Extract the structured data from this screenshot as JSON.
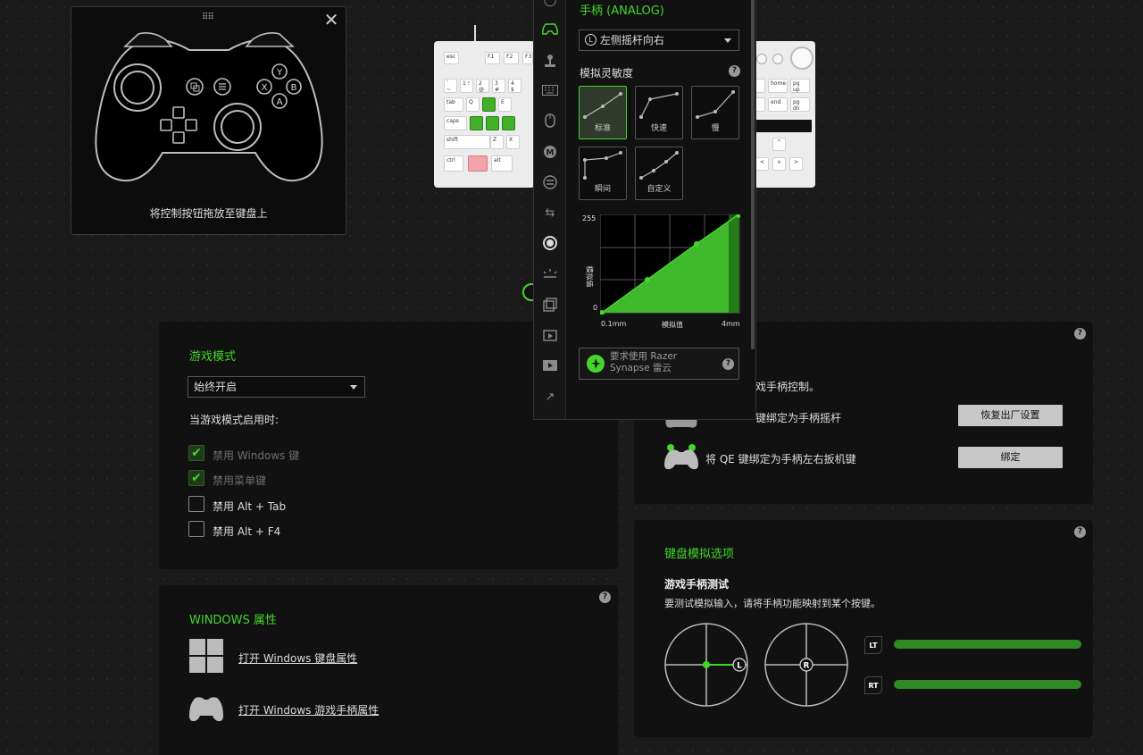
{
  "controller_panel": {
    "caption": "将控制按钮拖放至键盘上",
    "buttons": {
      "y": "Y",
      "x": "X",
      "b": "B",
      "a": "A"
    }
  },
  "keyboard": {
    "left_keys": {
      "esc": "esc",
      "f1": "F1",
      "f2": "F2",
      "f3": "F3",
      "tilde": "` ~",
      "one": "1 !",
      "two": "2 @",
      "three": "3 #",
      "four": "4 $",
      "tab": "tab",
      "q": "Q",
      "e": "E",
      "caps": "caps",
      "shift": "shift",
      "z": "Z",
      "x": "X",
      "ctrl": "ctrl",
      "alt": "alt"
    },
    "right_keys": {
      "home": "home",
      "pgup": "pg up",
      "end": "end",
      "pgdn": "pg dn",
      "up": "^",
      "left": "<",
      "down": "v",
      "right": ">"
    }
  },
  "analog_popup": {
    "header": "手柄 (ANALOG)",
    "stick_dropdown": {
      "icon": "L",
      "value": "左侧摇杆向右"
    },
    "sensitivity_label": "模拟灵敏度",
    "presets": [
      "标准",
      "快速",
      "慢",
      "瞬间",
      "自定义"
    ],
    "active_preset": "标准",
    "graph": {
      "y_max": "255",
      "y_min": "0",
      "y_label": "模拟值",
      "x_min": "0.1mm",
      "x_label": "模拟值",
      "x_max": "4mm"
    },
    "cloud_notice": "要求使用 Razer Synapse 雷云"
  },
  "toolbar_icons": [
    "circle-icon",
    "gamepad-icon",
    "joystick-icon",
    "keyboard-icon",
    "mouse-icon",
    "macro-icon",
    "switch-icon",
    "swap-icon",
    "sensitivity-icon",
    "lighting-icon",
    "launch-program-icon",
    "multimedia-icon",
    "video-icon",
    "shortcut-icon"
  ],
  "game_mode": {
    "title": "游戏模式",
    "dropdown_value": "始终开启",
    "subtitle": "当游戏模式启用时:",
    "options": [
      {
        "label": "禁用 Windows 键",
        "checked": true,
        "disabled": true
      },
      {
        "label": "禁用菜单键",
        "checked": true,
        "disabled": true
      },
      {
        "label": "禁用 Alt + Tab",
        "checked": false,
        "disabled": false
      },
      {
        "label": "禁用 Alt + F4",
        "checked": false,
        "disabled": false
      }
    ]
  },
  "windows_props": {
    "title": "WINDOWS 属性",
    "keyboard_link": "打开 Windows 键盘属性",
    "gamepad_link": "打开 Windows 游戏手柄属性"
  },
  "gamepad_control": {
    "intro": "戏手柄控制。",
    "row1": {
      "text": "键绑定为手柄摇杆",
      "button": "恢复出厂设置"
    },
    "row2": {
      "text": "将 QE 键绑定为手柄左右扳机键",
      "button": "绑定"
    }
  },
  "emulation": {
    "title": "键盘模拟选项",
    "test_title": "游戏手柄测试",
    "test_desc": "要测试模拟输入，请将手柄功能映射到某个按键。",
    "left_stick": "L",
    "right_stick": "R",
    "lt": "LT",
    "rt": "RT",
    "lt_level": 1.0,
    "rt_level": 1.0
  },
  "colors": {
    "accent": "#44d62c",
    "panel": "#111111",
    "background": "#1a1a1a"
  }
}
